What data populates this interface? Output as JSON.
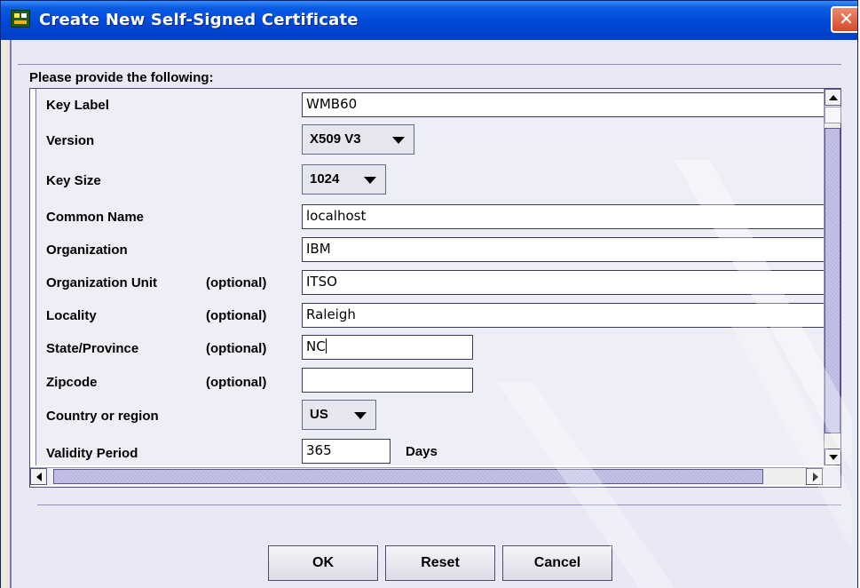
{
  "window": {
    "title": "Create New Self-Signed Certificate",
    "close_symbol": "✕"
  },
  "form": {
    "section_label": "Please provide the following:",
    "optional_marker": "(optional)",
    "key_label": {
      "label": "Key Label",
      "value": "WMB60"
    },
    "version": {
      "label": "Version",
      "selected": "X509 V3"
    },
    "key_size": {
      "label": "Key Size",
      "selected": "1024"
    },
    "common_name": {
      "label": "Common Name",
      "value": "localhost"
    },
    "organization": {
      "label": "Organization",
      "value": "IBM"
    },
    "organization_unit": {
      "label": "Organization Unit",
      "value": "ITSO"
    },
    "locality": {
      "label": "Locality",
      "value": "Raleigh"
    },
    "state_province": {
      "label": "State/Province",
      "value": "NC"
    },
    "zipcode": {
      "label": "Zipcode",
      "value": ""
    },
    "country": {
      "label": "Country or region",
      "selected": "US"
    },
    "validity_period": {
      "label": "Validity Period",
      "value": "365",
      "unit": "Days"
    }
  },
  "buttons": {
    "ok": "OK",
    "reset": "Reset",
    "cancel": "Cancel"
  },
  "icons": {
    "app": "key-database-icon",
    "close": "close-icon",
    "dropdown": "chevron-down-icon"
  },
  "colors": {
    "titlebar": "#0048d8",
    "close_button": "#d5492a",
    "dialog_background": "#e9e8f4",
    "scroll_thumb": "#b8b8e0"
  }
}
